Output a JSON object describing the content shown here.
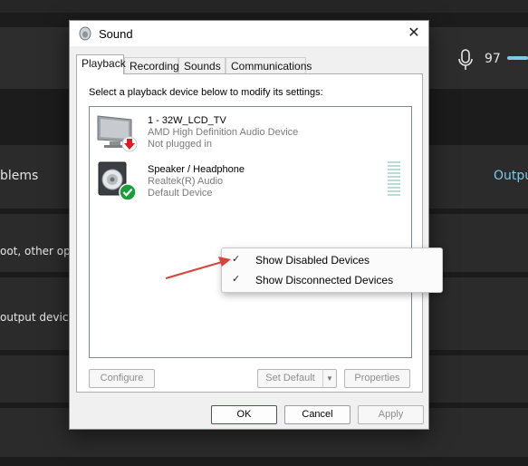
{
  "background": {
    "volume_value": "97",
    "row_problems_text": "blems",
    "row_output_link": "Outpu",
    "row_other_options_text": "oot, other opti",
    "row_output_devices_text": "output devices",
    "accent_color": "#7fc8e8"
  },
  "dialog": {
    "title": "Sound",
    "close_glyph": "✕",
    "tabs": [
      "Playback",
      "Recording",
      "Sounds",
      "Communications"
    ],
    "active_tab": "Playback",
    "instruction": "Select a playback device below to modify its settings:",
    "devices": [
      {
        "name": "1 - 32W_LCD_TV",
        "driver": "AMD High Definition Audio Device",
        "status": "Not plugged in",
        "icon": "monitor-icon",
        "badge": "red-down-arrow-icon"
      },
      {
        "name": "Speaker / Headphone",
        "driver": "Realtek(R) Audio",
        "status": "Default Device",
        "icon": "speaker-icon",
        "badge": "green-check-icon"
      }
    ],
    "buttons": {
      "configure": "Configure",
      "set_default": "Set Default",
      "set_default_arrow": "▼",
      "properties": "Properties",
      "ok": "OK",
      "cancel": "Cancel",
      "apply": "Apply"
    }
  },
  "context_menu": {
    "items": [
      {
        "label": "Show Disabled Devices",
        "checked": true,
        "check_glyph": "✓"
      },
      {
        "label": "Show Disconnected Devices",
        "checked": true,
        "check_glyph": "✓"
      }
    ]
  },
  "colors": {
    "annotation_arrow": "#d9443a",
    "default_button_border": "#0067c0",
    "check_badge": "#1a9e3a",
    "down_arrow_badge": "#d81e1e"
  }
}
